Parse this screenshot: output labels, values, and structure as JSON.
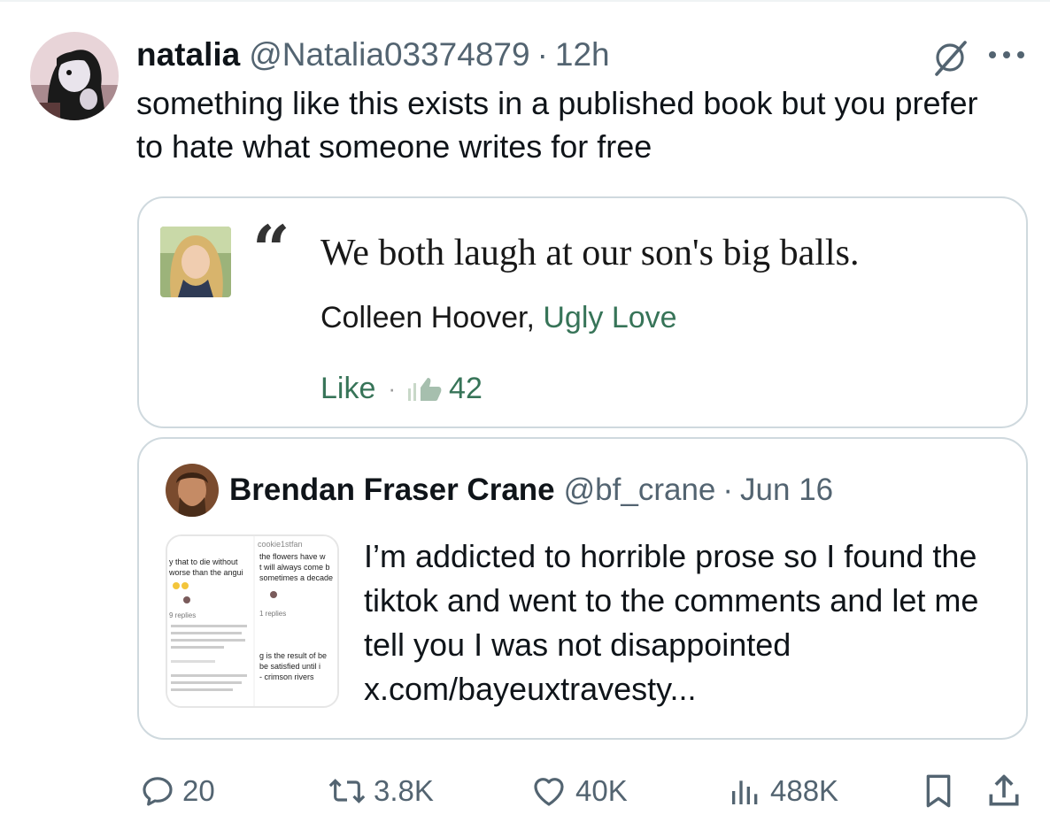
{
  "post": {
    "author_name": "natalia",
    "author_handle": "@Natalia03374879",
    "separator": "·",
    "time": "12h",
    "text": "something like this exists in a published book but you prefer to hate what someone writes for free"
  },
  "quote_card": {
    "quote_mark": "“",
    "quote": "We both laugh at our son's big balls.",
    "author": "Colleen Hoover,",
    "book": "Ugly Love",
    "like_label": "Like",
    "separator": "·",
    "like_count": "42"
  },
  "embedded_post": {
    "author_name": "Brendan Fraser Crane",
    "author_handle": "@bf_crane",
    "separator": "·",
    "date": "Jun 16",
    "text": "I’m addicted to horrible prose so I found the tiktok and went to the comments and let me tell you I was not disappointed",
    "link": "x.com/bayeuxtravesty...",
    "thumbnail": {
      "user": "cookie1stfan",
      "lines_right": [
        "the flowers have w",
        "t will always come b",
        "sometimes a decade"
      ],
      "lines_left": [
        "y that to die without",
        "worse than the angui"
      ],
      "replies_a": "9 replies",
      "replies_b": "1 replies",
      "lines_right_2": [
        "g is the result of be",
        "be satisfied until i",
        "- crimson rivers"
      ]
    }
  },
  "actions": {
    "replies": "20",
    "reposts": "3.8K",
    "likes": "40K",
    "views": "488K"
  },
  "colors": {
    "text_primary": "#0f1419",
    "text_secondary": "#536471",
    "border": "#cfd9de",
    "goodreads_green": "#377458"
  },
  "icons": [
    "grok-icon",
    "more-icon",
    "thumbs-up-icon",
    "reply-icon",
    "repost-icon",
    "heart-icon",
    "views-icon",
    "bookmark-icon",
    "share-icon"
  ]
}
